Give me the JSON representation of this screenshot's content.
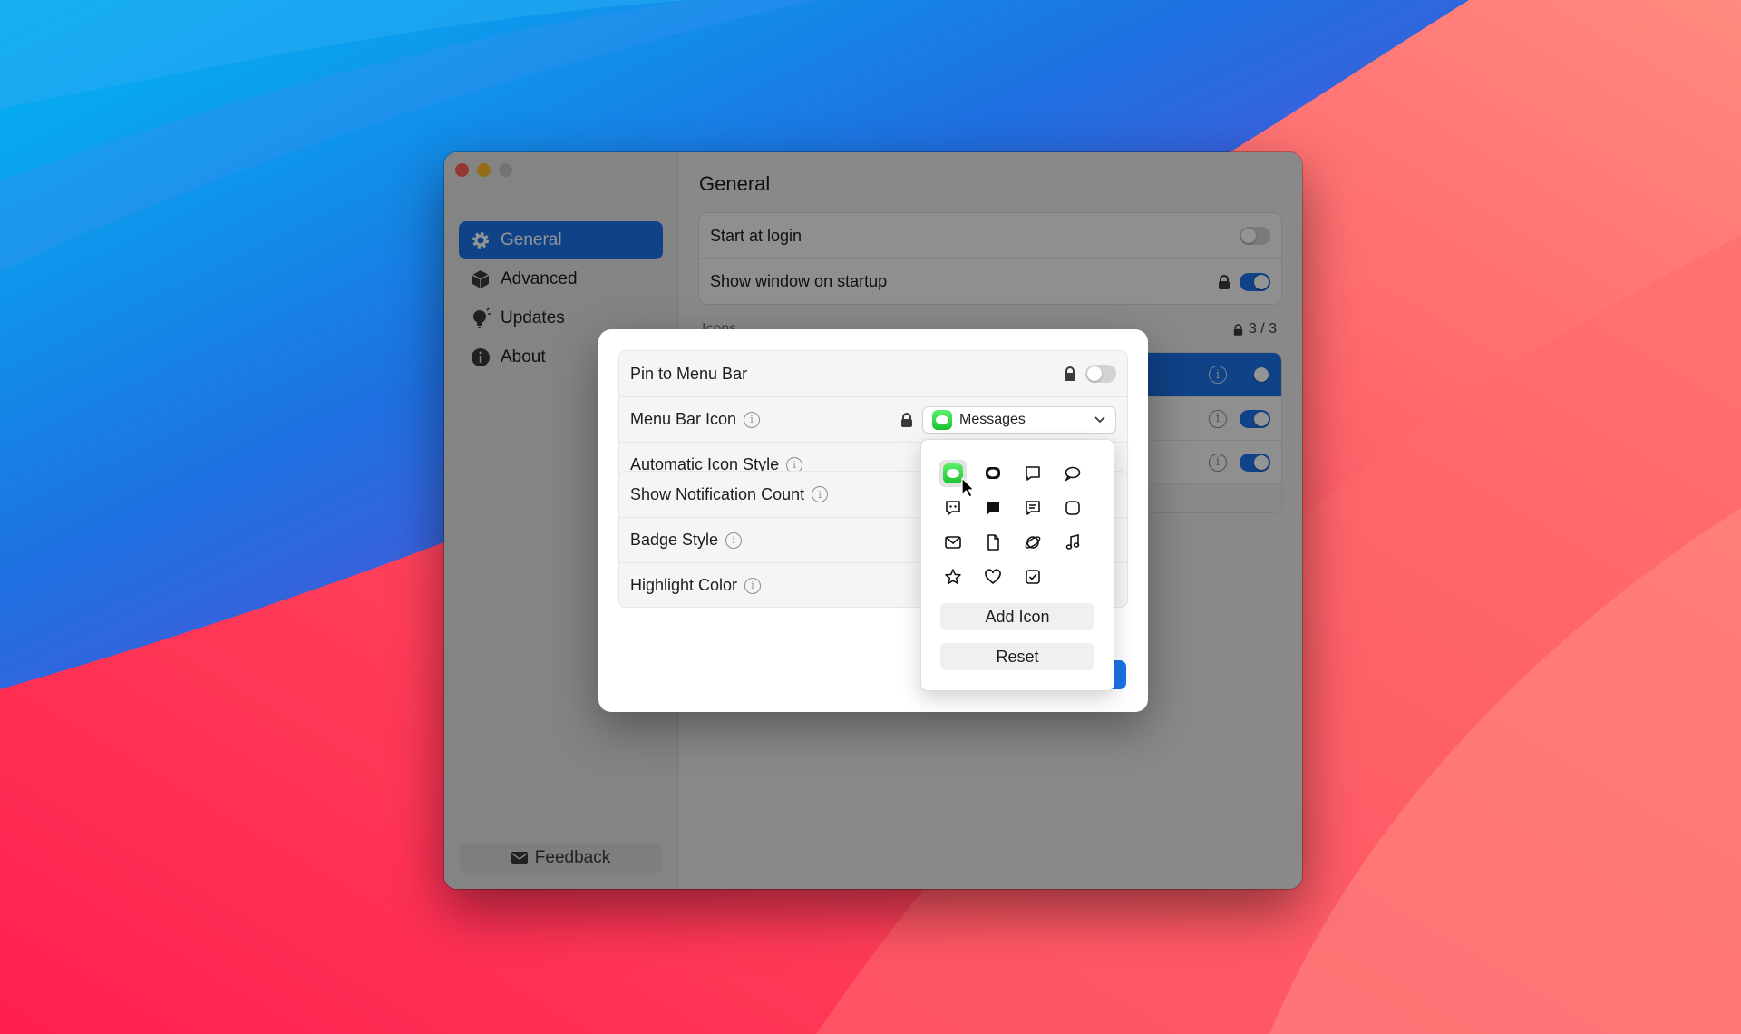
{
  "window": {
    "sidebar": {
      "items": [
        {
          "label": "General",
          "icon": "gear-icon",
          "active": true
        },
        {
          "label": "Advanced",
          "icon": "cube-icon",
          "active": false
        },
        {
          "label": "Updates",
          "icon": "lightbulb-icon",
          "active": false
        },
        {
          "label": "About",
          "icon": "info-icon",
          "active": false
        }
      ],
      "feedback_label": "Feedback"
    },
    "main": {
      "title": "General",
      "rows": [
        {
          "label": "Start at login",
          "on": false
        },
        {
          "label": "Show window on startup",
          "on": true
        }
      ],
      "icons_section_label": "Icons",
      "icons_count": "3 / 3"
    }
  },
  "sheet": {
    "group1": {
      "pin_label": "Pin to Menu Bar",
      "menu_bar_icon_label": "Menu Bar Icon",
      "menu_bar_icon_value": "Messages",
      "auto_icon_style_label": "Automatic Icon Style"
    },
    "group2": {
      "show_count_label": "Show Notification Count",
      "badge_style_label": "Badge Style",
      "highlight_color_label": "Highlight Color"
    }
  },
  "popover": {
    "icons": [
      "messages-icon",
      "bubble-filled-icon",
      "bubble-square-icon",
      "bubble-round-icon",
      "bubble-dots-icon",
      "bubble-square-filled-icon",
      "bubble-text-icon",
      "rounded-square-icon",
      "envelope-icon",
      "document-icon",
      "planet-icon",
      "music-note-icon",
      "star-icon",
      "heart-icon",
      "checkbox-icon"
    ],
    "add_icon_label": "Add Icon",
    "reset_label": "Reset"
  },
  "colors": {
    "accent": "#1a73e8",
    "messages_green": "#27c93f"
  }
}
